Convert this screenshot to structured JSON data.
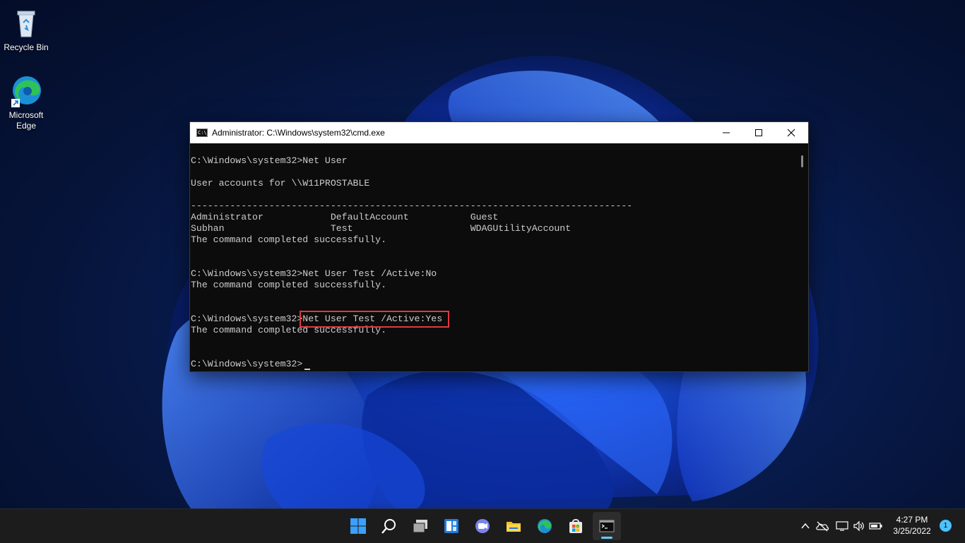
{
  "desktop": {
    "icons": [
      {
        "label": "Recycle Bin",
        "icon": "recycle-bin-icon"
      },
      {
        "label": "Microsoft Edge",
        "label_line1": "Microsoft",
        "label_line2": "Edge",
        "icon": "edge-icon"
      }
    ]
  },
  "cmd": {
    "title": "Administrator: C:\\Windows\\system32\\cmd.exe",
    "app_icon_text": "C:\\_",
    "lines": [
      "C:\\Windows\\system32>Net User",
      "User accounts for \\\\W11PROSTABLE",
      "-------------------------------------------------------------------------------",
      "Administrator            DefaultAccount           Guest",
      "Subhan                   Test                     WDAGUtilityAccount",
      "The command completed successfully.",
      "C:\\Windows\\system32>Net User Test /Active:No",
      "The command completed successfully.",
      "C:\\Windows\\system32>Net User Test /Active:Yes",
      "The command completed successfully.",
      "C:\\Windows\\system32>"
    ],
    "highlighted_command": "Net User Test /Active:Yes",
    "highlight_color": "#e0393e"
  },
  "taskbar": {
    "apps": [
      "start-icon",
      "search-icon",
      "task-view-icon",
      "widgets-icon",
      "teams-chat-icon",
      "file-explorer-icon",
      "edge-icon",
      "store-icon",
      "terminal-icon"
    ],
    "active_app": "terminal-icon",
    "accent": "#60cdff"
  },
  "tray": {
    "icons": [
      "chevron-up-icon",
      "onedrive-offline-icon",
      "display-icon",
      "volume-icon",
      "battery-icon"
    ],
    "time": "4:27 PM",
    "date": "3/25/2022",
    "notification_count": "1"
  }
}
